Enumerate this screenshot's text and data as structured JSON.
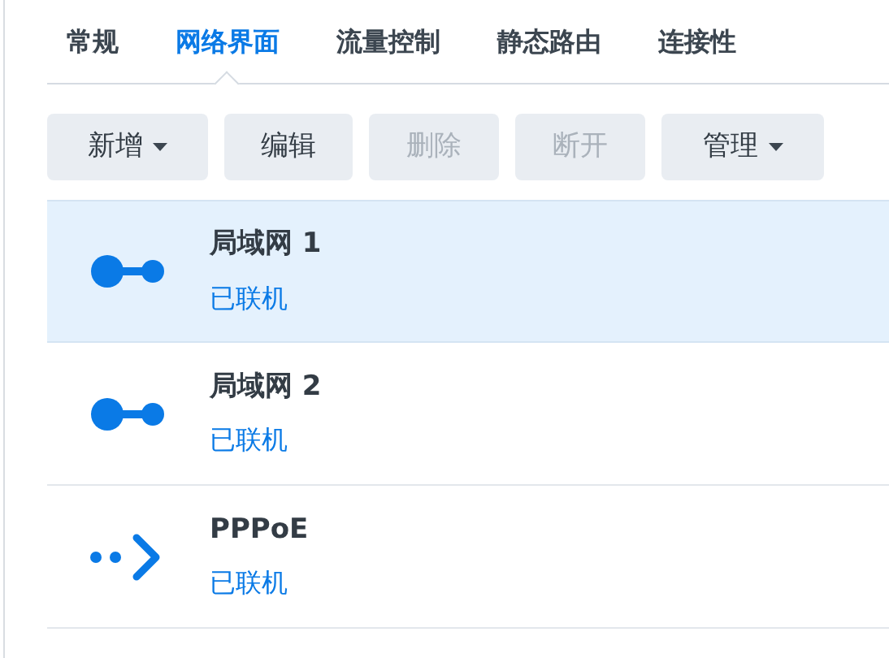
{
  "tabs": [
    {
      "label": "常规",
      "selected": false
    },
    {
      "label": "网络界面",
      "selected": true
    },
    {
      "label": "流量控制",
      "selected": false
    },
    {
      "label": "静态路由",
      "selected": false
    },
    {
      "label": "连接性",
      "selected": false
    }
  ],
  "toolbar": [
    {
      "label": "新增",
      "dropdown": true,
      "disabled": false
    },
    {
      "label": "编辑",
      "dropdown": false,
      "disabled": false
    },
    {
      "label": "删除",
      "dropdown": false,
      "disabled": true
    },
    {
      "label": "断开",
      "dropdown": false,
      "disabled": true
    },
    {
      "label": "管理",
      "dropdown": true,
      "disabled": false
    }
  ],
  "interfaces": [
    {
      "kind": "lan",
      "name": "局域网 1",
      "status": "已联机",
      "selected": true
    },
    {
      "kind": "lan",
      "name": "局域网 2",
      "status": "已联机",
      "selected": false
    },
    {
      "kind": "pppoe",
      "name": "PPPoE",
      "status": "已联机",
      "selected": false
    }
  ]
}
